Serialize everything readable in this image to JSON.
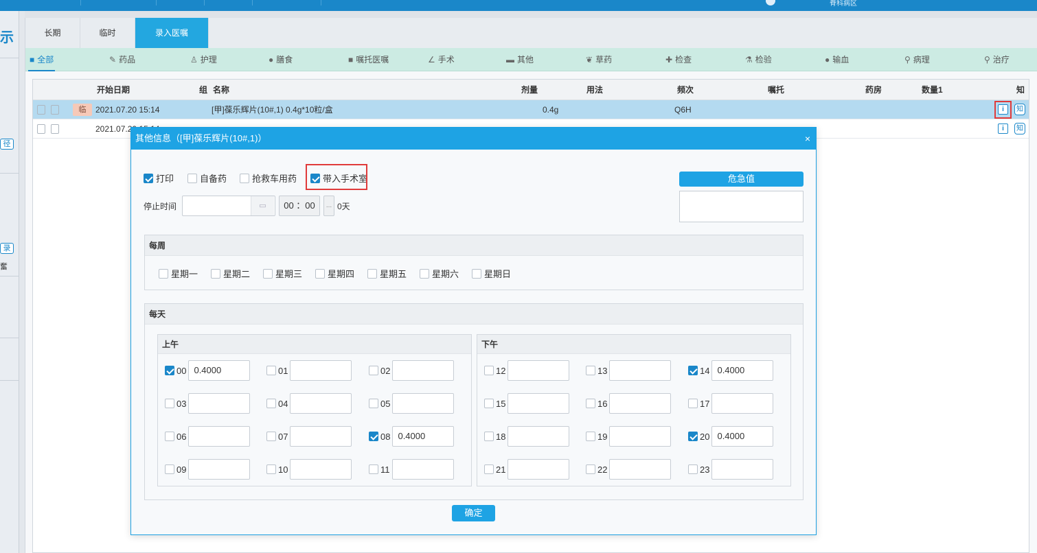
{
  "topbar": {
    "ward": "脊科病区"
  },
  "leftstrip": {
    "glyph": "示",
    "btn1": "径",
    "btn2": "录",
    "txt": "奮"
  },
  "tabs": [
    "长期",
    "临时",
    "录入医嘱"
  ],
  "active_tab": "录入医嘱",
  "categories": [
    {
      "icon": "grid-icon",
      "label": "全部"
    },
    {
      "icon": "pill-icon",
      "label": "药品"
    },
    {
      "icon": "nurse-icon",
      "label": "护理"
    },
    {
      "icon": "meal-icon",
      "label": "膳食"
    },
    {
      "icon": "entrust-icon",
      "label": "嘱托医嘱"
    },
    {
      "icon": "scalpel-icon",
      "label": "手术"
    },
    {
      "icon": "folder-icon",
      "label": "其他"
    },
    {
      "icon": "herb-icon",
      "label": "草药"
    },
    {
      "icon": "exam-icon",
      "label": "检查"
    },
    {
      "icon": "lab-icon",
      "label": "检验"
    },
    {
      "icon": "blood-icon",
      "label": "输血"
    },
    {
      "icon": "microscope-icon",
      "label": "病理"
    },
    {
      "icon": "treatment-icon",
      "label": "治疗"
    }
  ],
  "grid": {
    "headers": [
      "开始日期",
      "组",
      "名称",
      "剂量",
      "用法",
      "频次",
      "嘱托",
      "药房",
      "数量1",
      "知"
    ],
    "rows": [
      {
        "tag": "临",
        "start": "2021.07.20 15:14",
        "name": "[甲]葆乐辉片(10#,1) 0.4g*10粒/盒",
        "dose": "0.4g",
        "freq": "Q6H",
        "zhi": "知"
      },
      {
        "tag": "",
        "start": "2021.07.20 15:14",
        "name": "",
        "dose": "",
        "freq": "",
        "zhi": "知"
      }
    ]
  },
  "modal": {
    "title": "其他信息（[甲]葆乐辉片(10#,1)）",
    "close": "×",
    "options": [
      {
        "label": "打印",
        "checked": true
      },
      {
        "label": "自备药",
        "checked": false
      },
      {
        "label": "抢救车用药",
        "checked": false
      },
      {
        "label": "带入手术室",
        "checked": true
      }
    ],
    "stop_label": "停止时间",
    "stop_date": "",
    "stop_time": "00 ：00",
    "more": "...",
    "days": "0天",
    "critical_button": "危急值",
    "critical_value": "",
    "weekly_title": "每周",
    "weekdays": [
      {
        "label": "星期一",
        "checked": false
      },
      {
        "label": "星期二",
        "checked": false
      },
      {
        "label": "星期三",
        "checked": false
      },
      {
        "label": "星期四",
        "checked": false
      },
      {
        "label": "星期五",
        "checked": false
      },
      {
        "label": "星期六",
        "checked": false
      },
      {
        "label": "星期日",
        "checked": false
      }
    ],
    "daily_title": "每天",
    "am_title": "上午",
    "pm_title": "下午",
    "am_hours": [
      {
        "hour": "00",
        "checked": true,
        "value": "0.4000"
      },
      {
        "hour": "01",
        "checked": false,
        "value": ""
      },
      {
        "hour": "02",
        "checked": false,
        "value": ""
      },
      {
        "hour": "03",
        "checked": false,
        "value": ""
      },
      {
        "hour": "04",
        "checked": false,
        "value": ""
      },
      {
        "hour": "05",
        "checked": false,
        "value": ""
      },
      {
        "hour": "06",
        "checked": false,
        "value": ""
      },
      {
        "hour": "07",
        "checked": false,
        "value": ""
      },
      {
        "hour": "08",
        "checked": true,
        "value": "0.4000"
      },
      {
        "hour": "09",
        "checked": false,
        "value": ""
      },
      {
        "hour": "10",
        "checked": false,
        "value": ""
      },
      {
        "hour": "11",
        "checked": false,
        "value": ""
      }
    ],
    "pm_hours": [
      {
        "hour": "12",
        "checked": false,
        "value": ""
      },
      {
        "hour": "13",
        "checked": false,
        "value": ""
      },
      {
        "hour": "14",
        "checked": true,
        "value": "0.4000"
      },
      {
        "hour": "15",
        "checked": false,
        "value": ""
      },
      {
        "hour": "16",
        "checked": false,
        "value": ""
      },
      {
        "hour": "17",
        "checked": false,
        "value": ""
      },
      {
        "hour": "18",
        "checked": false,
        "value": ""
      },
      {
        "hour": "19",
        "checked": false,
        "value": ""
      },
      {
        "hour": "20",
        "checked": true,
        "value": "0.4000"
      },
      {
        "hour": "21",
        "checked": false,
        "value": ""
      },
      {
        "hour": "22",
        "checked": false,
        "value": ""
      },
      {
        "hour": "23",
        "checked": false,
        "value": ""
      }
    ],
    "ok_button": "确定"
  },
  "colors": {
    "accent": "#1ea3e4",
    "selected_row": "#b4daf0",
    "category_bar": "#ccebe3",
    "highlight_box": "#e03a3a"
  }
}
